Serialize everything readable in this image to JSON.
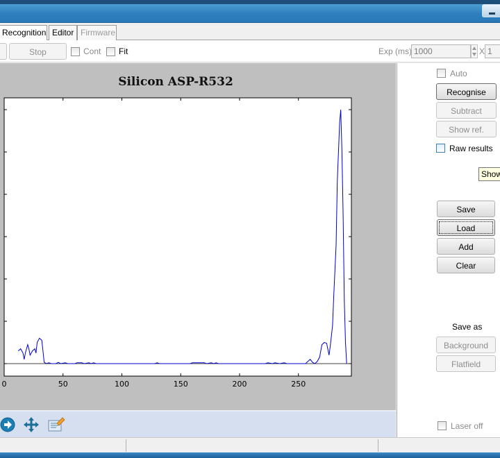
{
  "tabs": [
    {
      "label": "Recognition"
    },
    {
      "label": "Editor"
    },
    {
      "label": "Firmware"
    }
  ],
  "toolbar": {
    "stop_label": "Stop",
    "cont_label": "Cont",
    "fit_label": "Fit",
    "exp_label": "Exp (ms)",
    "exp_value": "1000",
    "x_label": "X",
    "x_value": "1"
  },
  "right_panel": {
    "auto_label": "Auto",
    "recognise_label": "Recognise",
    "subtract_label": "Subtract",
    "show_ref_label": "Show ref.",
    "raw_results_label": "Raw results",
    "tooltip_text": "Show",
    "save_label": "Save",
    "load_label": "Load",
    "add_label": "Add",
    "clear_label": "Clear",
    "save_as_label": "Save as",
    "background_label": "Background",
    "flatfield_label": "Flatfield",
    "laser_off_label": "Laser off"
  },
  "chart_data": {
    "type": "line",
    "title": "Silicon ASP-R532",
    "xlabel": "",
    "ylabel": "",
    "xlim": [
      0,
      295
    ],
    "ylim": [
      0,
      60
    ],
    "x_ticks": [
      0,
      50,
      100,
      150,
      200,
      250
    ],
    "x_tick_labels": [
      "0",
      "50",
      "100",
      "150",
      "200",
      "250"
    ],
    "y_ticks": [
      0,
      10,
      20,
      30,
      40,
      50,
      60
    ],
    "grid": false,
    "series": [
      {
        "name": "",
        "color": "#0000cc",
        "points": [
          [
            12,
            3
          ],
          [
            14,
            3.5
          ],
          [
            16,
            2.5
          ],
          [
            17,
            1
          ],
          [
            18,
            2.5
          ],
          [
            20,
            4.5
          ],
          [
            21,
            3.5
          ],
          [
            22,
            2
          ],
          [
            24,
            3
          ],
          [
            26,
            3.5
          ],
          [
            27,
            2.5
          ],
          [
            28,
            5
          ],
          [
            30,
            6
          ],
          [
            32,
            5.5
          ],
          [
            33,
            3
          ],
          [
            34,
            0.3
          ],
          [
            36,
            0
          ],
          [
            38,
            0.2
          ],
          [
            40,
            0
          ],
          [
            44,
            0
          ],
          [
            46,
            0.3
          ],
          [
            48,
            0
          ],
          [
            52,
            0.2
          ],
          [
            54,
            0
          ],
          [
            60,
            0
          ],
          [
            62,
            0.2
          ],
          [
            66,
            0.2
          ],
          [
            68,
            0
          ],
          [
            72,
            0.2
          ],
          [
            74,
            0
          ],
          [
            76,
            0.2
          ],
          [
            78,
            0
          ],
          [
            128,
            0
          ],
          [
            130,
            0.2
          ],
          [
            132,
            0
          ],
          [
            158,
            0
          ],
          [
            160,
            0.2
          ],
          [
            170,
            0.2
          ],
          [
            172,
            0
          ],
          [
            176,
            0.2
          ],
          [
            178,
            0
          ],
          [
            180,
            0.2
          ],
          [
            182,
            0
          ],
          [
            222,
            0
          ],
          [
            224,
            0.2
          ],
          [
            228,
            0
          ],
          [
            230,
            0.2
          ],
          [
            234,
            0
          ],
          [
            238,
            0.2
          ],
          [
            240,
            0
          ],
          [
            256,
            0
          ],
          [
            258,
            0.5
          ],
          [
            260,
            1
          ],
          [
            262,
            0.3
          ],
          [
            264,
            0
          ],
          [
            266,
            0.5
          ],
          [
            268,
            1.5
          ],
          [
            270,
            4.5
          ],
          [
            272,
            5
          ],
          [
            274,
            4.8
          ],
          [
            276,
            2
          ],
          [
            277,
            4
          ],
          [
            279,
            9
          ],
          [
            280,
            16
          ],
          [
            282,
            28
          ],
          [
            283,
            43
          ],
          [
            285,
            57
          ],
          [
            286,
            60
          ],
          [
            287,
            50
          ],
          [
            288,
            35
          ],
          [
            289,
            15
          ],
          [
            290,
            5
          ],
          [
            291,
            0
          ]
        ]
      }
    ]
  }
}
